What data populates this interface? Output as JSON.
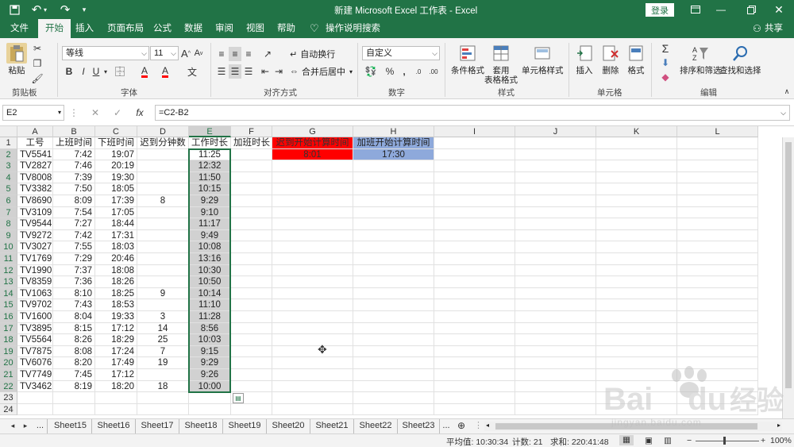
{
  "title_bar": {
    "autosave_icon": "save-icon",
    "undo": "↶",
    "title": "新建 Microsoft Excel 工作表 - Excel",
    "login": "登录"
  },
  "ribbon_tabs": [
    "文件",
    "开始",
    "插入",
    "页面布局",
    "公式",
    "数据",
    "审阅",
    "视图",
    "帮助"
  ],
  "ribbon_active_tab": "开始",
  "tell_me": "操作说明搜索",
  "share": "共享",
  "clipboard": {
    "paste": "粘贴",
    "group": "剪贴板"
  },
  "font": {
    "name": "等线",
    "size": "11",
    "grow": "A",
    "shrink": "A",
    "bold": "B",
    "italic": "I",
    "underline": "U",
    "font_color_letter": "A",
    "fill_letter": "A",
    "wen": "文",
    "group": "字体"
  },
  "alignment": {
    "wrap": "自动换行",
    "merge": "合并后居中",
    "group": "对齐方式"
  },
  "number": {
    "format": "自定义",
    "percent": "%",
    "comma": ",",
    "group": "数字",
    "dec_inc": ".0",
    "dec_dec": ".00"
  },
  "styles": {
    "cond": "条件格式",
    "table_1": "套用",
    "table_2": "表格格式",
    "cell_styles": "单元格样式",
    "group": "样式"
  },
  "cells": {
    "insert": "插入",
    "delete": "删除",
    "format": "格式",
    "group": "单元格"
  },
  "editing": {
    "sigma": "Σ",
    "sort": "排序和筛选",
    "find": "查找和选择",
    "group": "编辑"
  },
  "formula_bar": {
    "name_box": "E2",
    "cancel": "✕",
    "enter": "✓",
    "fx": "fx",
    "formula": "=C2-B2"
  },
  "columns": [
    "A",
    "B",
    "C",
    "D",
    "E",
    "F",
    "G",
    "H",
    "I",
    "J",
    "K",
    "L"
  ],
  "header_row": {
    "A": "工号",
    "B": "上班时间",
    "C": "下班时间",
    "D": "迟到分钟数",
    "E": "工作时长",
    "F": "加班时长",
    "G": "迟到开始计算时间",
    "H": "加班开始计算时间"
  },
  "row2_extra": {
    "G": "8:01",
    "H": "17:30"
  },
  "rows": [
    [
      "TV5541",
      "7:42",
      "19:07",
      "",
      "11:25"
    ],
    [
      "TV2827",
      "7:46",
      "20:19",
      "",
      "12:32"
    ],
    [
      "TV8008",
      "7:39",
      "19:30",
      "",
      "11:50"
    ],
    [
      "TV3382",
      "7:50",
      "18:05",
      "",
      "10:15"
    ],
    [
      "TV8690",
      "8:09",
      "17:39",
      "8",
      "9:29"
    ],
    [
      "TV3109",
      "7:54",
      "17:05",
      "",
      "9:10"
    ],
    [
      "TV9544",
      "7:27",
      "18:44",
      "",
      "11:17"
    ],
    [
      "TV9272",
      "7:42",
      "17:31",
      "",
      "9:49"
    ],
    [
      "TV3027",
      "7:55",
      "18:03",
      "",
      "10:08"
    ],
    [
      "TV1769",
      "7:29",
      "20:46",
      "",
      "13:16"
    ],
    [
      "TV1990",
      "7:37",
      "18:08",
      "",
      "10:30"
    ],
    [
      "TV8359",
      "7:36",
      "18:26",
      "",
      "10:50"
    ],
    [
      "TV1063",
      "8:10",
      "18:25",
      "9",
      "10:14"
    ],
    [
      "TV9702",
      "7:43",
      "18:53",
      "",
      "11:10"
    ],
    [
      "TV1600",
      "8:04",
      "19:33",
      "3",
      "11:28"
    ],
    [
      "TV3895",
      "8:15",
      "17:12",
      "14",
      "8:56"
    ],
    [
      "TV5564",
      "8:26",
      "18:29",
      "25",
      "10:03"
    ],
    [
      "TV7875",
      "8:08",
      "17:24",
      "7",
      "9:15"
    ],
    [
      "TV6076",
      "8:20",
      "17:49",
      "19",
      "9:29"
    ],
    [
      "TV7749",
      "7:45",
      "17:12",
      "",
      "9:26"
    ],
    [
      "TV3462",
      "8:19",
      "18:20",
      "18",
      "10:00"
    ]
  ],
  "row_numbers": [
    "1",
    "2",
    "3",
    "4",
    "5",
    "6",
    "7",
    "8",
    "9",
    "10",
    "11",
    "12",
    "13",
    "14",
    "15",
    "16",
    "17",
    "18",
    "19",
    "20",
    "21",
    "22",
    "23",
    "24"
  ],
  "sheet_tabs": [
    "Sheet15",
    "Sheet16",
    "Sheet17",
    "Sheet18",
    "Sheet19",
    "Sheet20",
    "Sheet21",
    "Sheet22",
    "Sheet23"
  ],
  "sheet_nav": {
    "prev": "◂",
    "next": "▸",
    "more": "...",
    "more2": "...",
    "add": "⊕"
  },
  "status": {
    "avg": "平均值: 10:30:34",
    "count": "计数: 21",
    "sum": "求和: 220:41:48",
    "zoom": "100%",
    "minus": "−",
    "plus": "+"
  },
  "colors": {
    "excel_green": "#217346",
    "g1_fill": "#ff0000",
    "h1_fill": "#8ea9db",
    "selection": "#d1d1d1"
  },
  "watermark": {
    "brand": "Bai",
    "brand2": "du",
    "cn": "经验",
    "url": "jingyan.baidu.com"
  }
}
